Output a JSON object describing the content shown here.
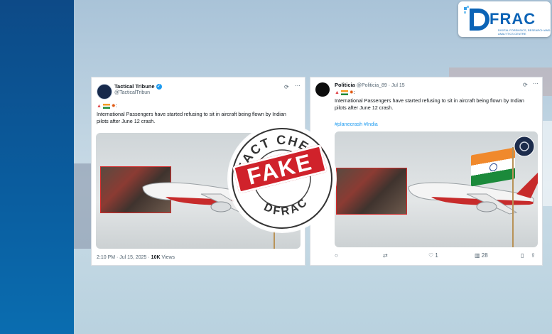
{
  "brand": {
    "logo_text": "FRAC",
    "logo_subtitle": "DIGITAL FORENSICS, RESEARCH AND ANALYTICS CENTRE"
  },
  "stamp": {
    "top_text": "FACT CHECK",
    "bottom_text": "DFRAC",
    "verdict": "FAKE"
  },
  "tweet_left": {
    "name": "Tactical Tribune",
    "handle": "@TacticalTribun",
    "body": "International Passengers have started refusing to sit in aircraft being flown by Indian pilots after June 12 crash.",
    "time": "2:10 PM · Jul 15, 2025 ·",
    "views_count": "10K",
    "views_label": "Views"
  },
  "tweet_right": {
    "name": "Politicia",
    "handle_date": "@Politicia_89 · Jul 15",
    "body": "International Passengers have started refusing to sit in aircraft being flown by Indian pilots after June 12 crash.",
    "hashtags": "#planecrash #India",
    "likes": "1",
    "views": "28"
  },
  "icons": [
    "grok-icon",
    "more-icon",
    "reply-icon",
    "retweet-icon",
    "like-icon",
    "views-icon",
    "bookmark-icon",
    "share-icon",
    "verified-icon"
  ],
  "colors": {
    "brand_blue": "#0b63b6",
    "stamp_red": "#d0222b",
    "link_blue": "#1d9bf0"
  }
}
